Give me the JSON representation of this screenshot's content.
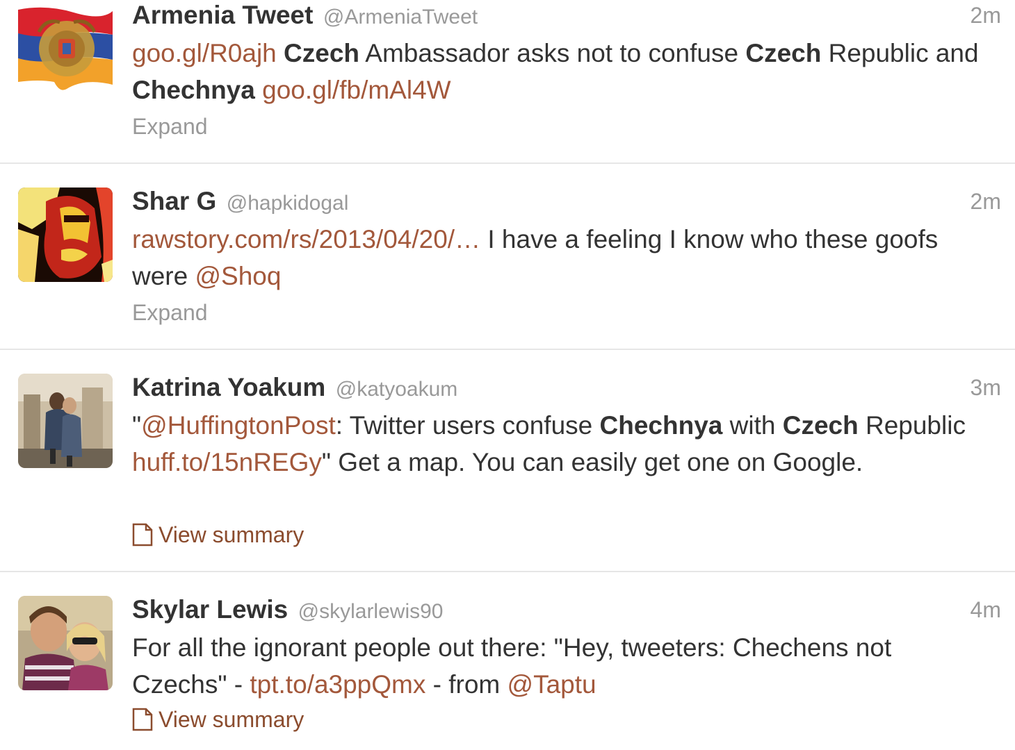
{
  "colors": {
    "link": "#a3583b",
    "meta": "#999999",
    "text": "#333333",
    "divider": "#e6e6e6"
  },
  "tweets": [
    {
      "name": "Armenia Tweet",
      "handle": "@ArmeniaTweet",
      "time": "2m",
      "avatar_icon": "armenia-flag-avatar",
      "parts": [
        {
          "t": "link",
          "v": "goo.gl/R0ajh"
        },
        {
          "t": "text",
          "v": " "
        },
        {
          "t": "bold",
          "v": "Czech"
        },
        {
          "t": "text",
          "v": " Ambassador asks not to confuse "
        },
        {
          "t": "bold",
          "v": "Czech"
        },
        {
          "t": "text",
          "v": " Republic and "
        },
        {
          "t": "bold",
          "v": "Chechnya"
        },
        {
          "t": "text",
          "v": " "
        },
        {
          "t": "link",
          "v": "goo.gl/fb/mAl4W"
        }
      ],
      "action": {
        "type": "expand",
        "label": "Expand"
      }
    },
    {
      "name": "Shar G",
      "handle": "@hapkidogal",
      "time": "2m",
      "avatar_icon": "face-art-avatar",
      "parts": [
        {
          "t": "link",
          "v": "rawstory.com/rs/2013/04/20/…"
        },
        {
          "t": "text",
          "v": "  I have a feeling I know who these goofs were "
        },
        {
          "t": "link",
          "v": "@Shoq"
        }
      ],
      "action": {
        "type": "expand",
        "label": "Expand"
      }
    },
    {
      "name": "Katrina Yoakum",
      "handle": "@katyoakum",
      "time": "3m",
      "avatar_icon": "couple-photo-avatar",
      "parts": [
        {
          "t": "text",
          "v": "\""
        },
        {
          "t": "link",
          "v": "@HuffingtonPost"
        },
        {
          "t": "text",
          "v": ": Twitter users confuse "
        },
        {
          "t": "bold",
          "v": "Chechnya"
        },
        {
          "t": "text",
          "v": " with "
        },
        {
          "t": "bold",
          "v": "Czech"
        },
        {
          "t": "text",
          "v": " Republic "
        },
        {
          "t": "link",
          "v": "huff.to/15nREGy"
        },
        {
          "t": "text",
          "v": "\" Get a map. You can easily get one on Google."
        }
      ],
      "action": {
        "type": "summary",
        "label": "View summary"
      }
    },
    {
      "name": "Skylar Lewis",
      "handle": "@skylarlewis90",
      "time": "4m",
      "avatar_icon": "selfie-photo-avatar",
      "parts": [
        {
          "t": "text",
          "v": "For all the ignorant people out there: \"Hey, tweeters: Chechens not Czechs\" - "
        },
        {
          "t": "link",
          "v": "tpt.to/a3ppQmx"
        },
        {
          "t": "text",
          "v": " - from "
        },
        {
          "t": "link",
          "v": "@Taptu"
        }
      ],
      "action": {
        "type": "summary",
        "label": "View summary"
      }
    }
  ]
}
